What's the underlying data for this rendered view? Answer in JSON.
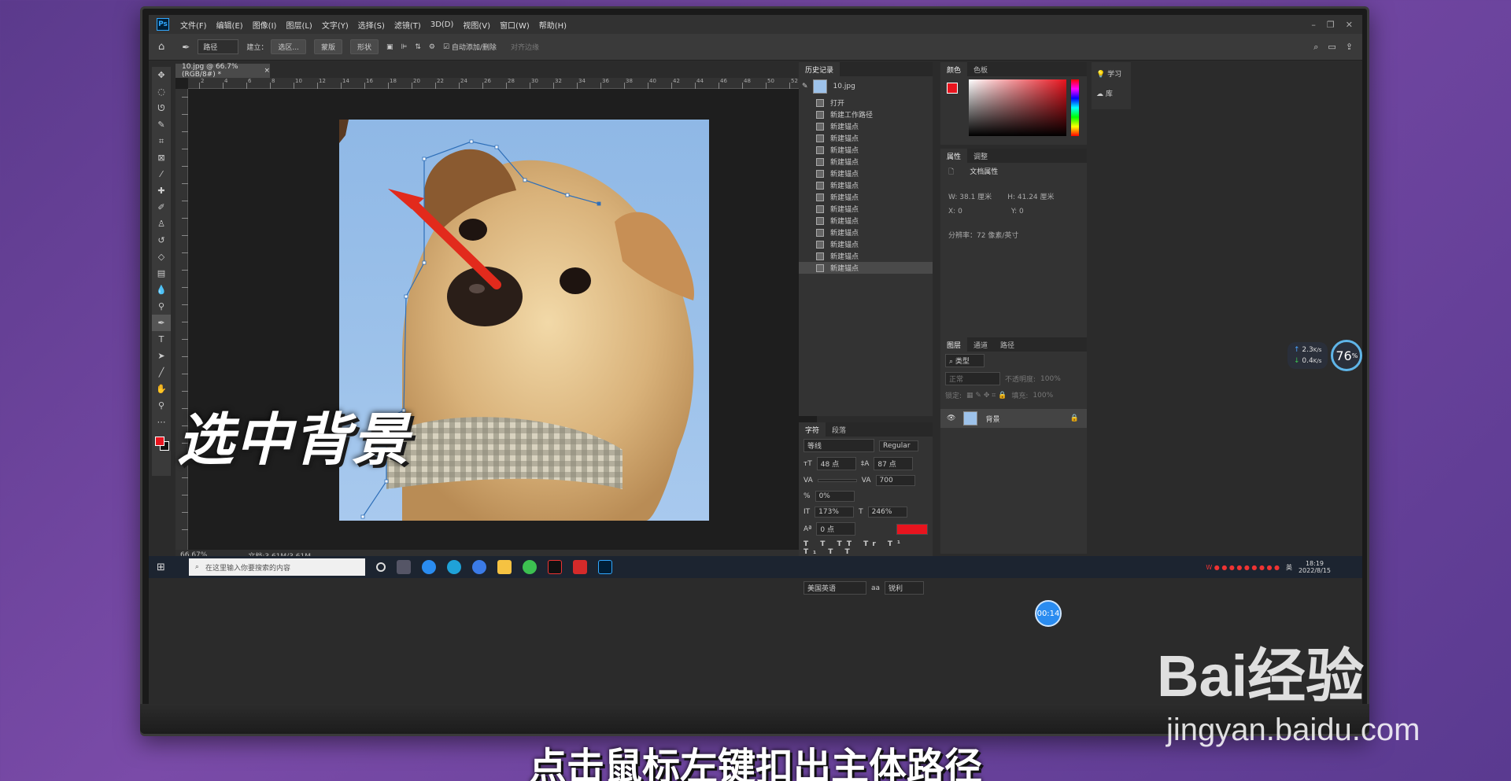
{
  "app": {
    "logo": "Ps",
    "menu": [
      "文件(F)",
      "编辑(E)",
      "图像(I)",
      "图层(L)",
      "文字(Y)",
      "选择(S)",
      "滤镜(T)",
      "3D(D)",
      "视图(V)",
      "窗口(W)",
      "帮助(H)"
    ]
  },
  "options": {
    "mode": "路径",
    "build_label": "建立：",
    "selection_btn": "选区...",
    "mask_btn": "蒙版",
    "shape_btn": "形状",
    "auto_add": "自动添加/删除",
    "align_edges": "对齐边缘"
  },
  "document": {
    "tab": "10.jpg @ 66.7%(RGB/8#) *",
    "zoom": "66.67%",
    "doc_size": "文档:3.61M/3.61M",
    "ruler_top": [
      "2",
      "4",
      "6",
      "8",
      "10",
      "12",
      "14",
      "16",
      "18",
      "20",
      "22",
      "24",
      "26",
      "28",
      "30",
      "32",
      "34",
      "36",
      "38",
      "40",
      "42",
      "44",
      "46",
      "48",
      "50",
      "52"
    ]
  },
  "history": {
    "tabs": [
      "历史记录"
    ],
    "snapshot": "10.jpg",
    "items": [
      "打开",
      "新建工作路径",
      "新建锚点",
      "新建锚点",
      "新建锚点",
      "新建锚点",
      "新建锚点",
      "新建锚点",
      "新建锚点",
      "新建锚点",
      "新建锚点",
      "新建锚点",
      "新建锚点",
      "新建锚点",
      "新建锚点"
    ]
  },
  "color": {
    "tabs": [
      "颜色",
      "色板"
    ],
    "foreground": "#e8141e"
  },
  "properties": {
    "tabs": [
      "属性",
      "调整"
    ],
    "section": "文档属性",
    "w_label": "W:",
    "w_value": "38.1 厘米",
    "h_label": "H:",
    "h_value": "41.24 厘米",
    "x_label": "X:",
    "x_value": "0",
    "y_label": "Y:",
    "y_value": "0",
    "resolution": "分辨率：72 像素/英寸"
  },
  "learn": {
    "learn": "学习",
    "library": "库"
  },
  "net": {
    "up": "2.3",
    "down": "0.4",
    "unit": "K/s",
    "percent": "76",
    "pct_sign": "%"
  },
  "character": {
    "tabs": [
      "字符",
      "段落"
    ],
    "font": "等线",
    "style": "Regular",
    "size": "48 点",
    "leading": "87 点",
    "tracking": "700",
    "scale": "0%",
    "vscale": "173%",
    "hscale": "246%",
    "baseline": "0 点",
    "language": "美国英语",
    "aa": "锐利"
  },
  "layers": {
    "tabs": [
      "图层",
      "通道",
      "路径"
    ],
    "kind": "类型",
    "blend": "正常",
    "opacity_label": "不透明度:",
    "opacity": "100%",
    "lock_label": "锁定:",
    "fill_label": "填充:",
    "fill": "100%",
    "layer_name": "背景"
  },
  "taskbar": {
    "search_placeholder": "在这里输入你要搜索的内容",
    "time": "18:19",
    "date": "2022/8/15",
    "ime": "英"
  },
  "timer": "00:14",
  "overlay_text": "选中背景",
  "subtitle": "点击鼠标左键扣出主体路径",
  "watermark": {
    "brand": "Bai经验",
    "url": "jingyan.baidu.com"
  }
}
